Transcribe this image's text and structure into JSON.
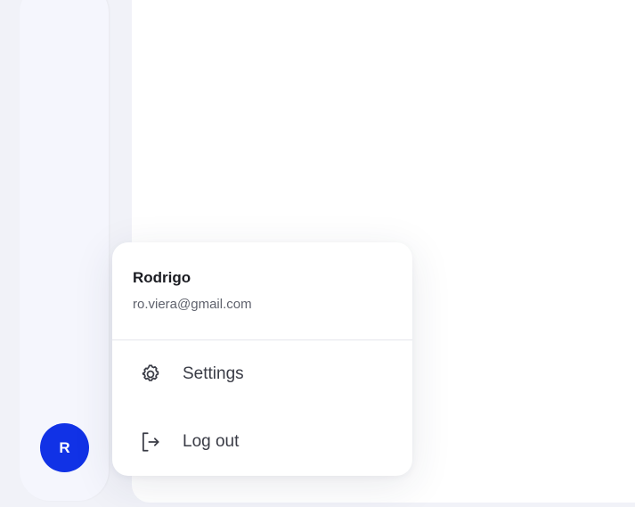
{
  "sidebar": {
    "avatar": {
      "initial": "R",
      "color": "#1132e6"
    }
  },
  "menu": {
    "user": {
      "name": "Rodrigo",
      "email": "ro.viera@gmail.com"
    },
    "items": [
      {
        "label": "Settings",
        "icon": "gear-icon"
      },
      {
        "label": "Log out",
        "icon": "logout-icon"
      }
    ]
  }
}
